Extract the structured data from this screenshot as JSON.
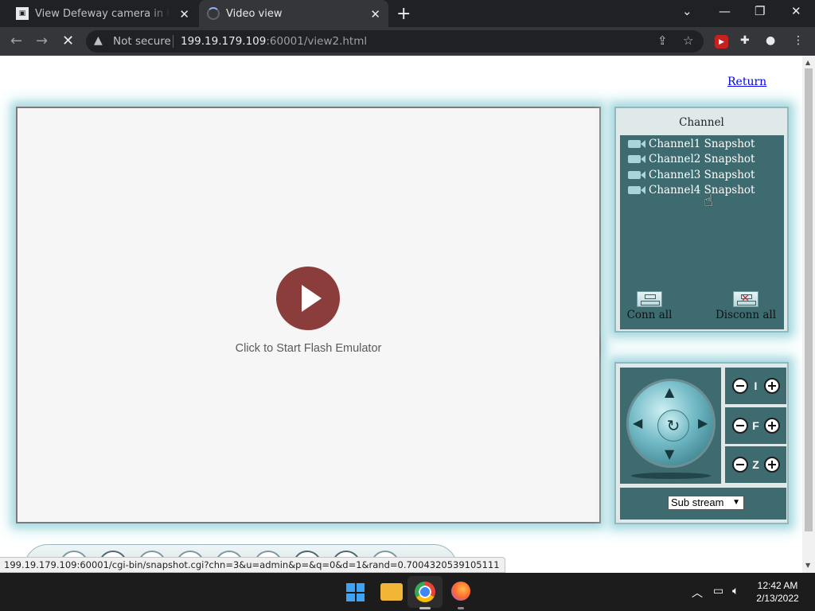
{
  "browser": {
    "tabs": [
      {
        "title": "View Defeway camera in United S",
        "active": false
      },
      {
        "title": "Video view",
        "active": true
      }
    ],
    "address": {
      "security_label": "Not secure",
      "url_host": "199.19.179.109",
      "url_rest": ":60001/view2.html"
    },
    "status_url": "199.19.179.109:60001/cgi-bin/snapshot.cgi?chn=3&u=admin&p=&q=0&d=1&rand=0.7004320539105111"
  },
  "page": {
    "return_link": "Return",
    "video": {
      "flash_prompt": "Click to Start Flash Emulator"
    },
    "channel_panel": {
      "title": "Channel",
      "channels": [
        {
          "label": "Channel1 Snapshot"
        },
        {
          "label": "Channel2 Snapshot"
        },
        {
          "label": "Channel3 Snapshot"
        },
        {
          "label": "Channel4 Snapshot"
        }
      ],
      "conn_all": "Conn all",
      "disconn_all": "Disconn all"
    },
    "controls": {
      "iris_label": "I",
      "focus_label": "F",
      "zoom_label": "Z",
      "stream_selected": "Sub stream"
    }
  },
  "taskbar": {
    "time": "12:42 AM",
    "date": "2/13/2022"
  },
  "colors": {
    "panel_teal": "#3d6b70",
    "play_button": "#8b3d3c",
    "link": "#0000ee"
  }
}
